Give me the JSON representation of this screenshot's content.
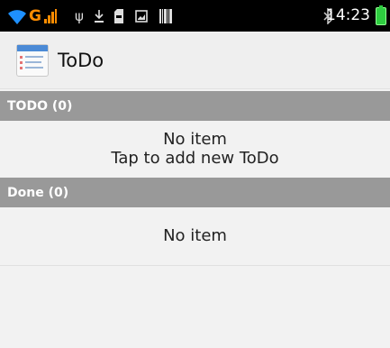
{
  "statusbar": {
    "time": "14:23",
    "colors": {
      "wifi": "#1e90ff",
      "signal": "#ff8c00",
      "battery": "#2ecc40"
    },
    "icons": [
      "wifi-icon",
      "signal-icon",
      "usb-icon",
      "download-icon",
      "sd-card-icon",
      "screenshot-icon",
      "barcode-icon",
      "bluetooth-icon",
      "battery-icon"
    ]
  },
  "actionbar": {
    "title": "ToDo",
    "icon": "todo-app-icon"
  },
  "todo_section": {
    "header": "TODO (0)",
    "empty_text": "No item",
    "hint_text": "Tap to add new ToDo"
  },
  "done_section": {
    "header": "Done (0)",
    "empty_text": "No item"
  },
  "colors": {
    "section_header_bg": "#999999",
    "background": "#f2f2f2",
    "statusbar_bg": "#000000"
  }
}
